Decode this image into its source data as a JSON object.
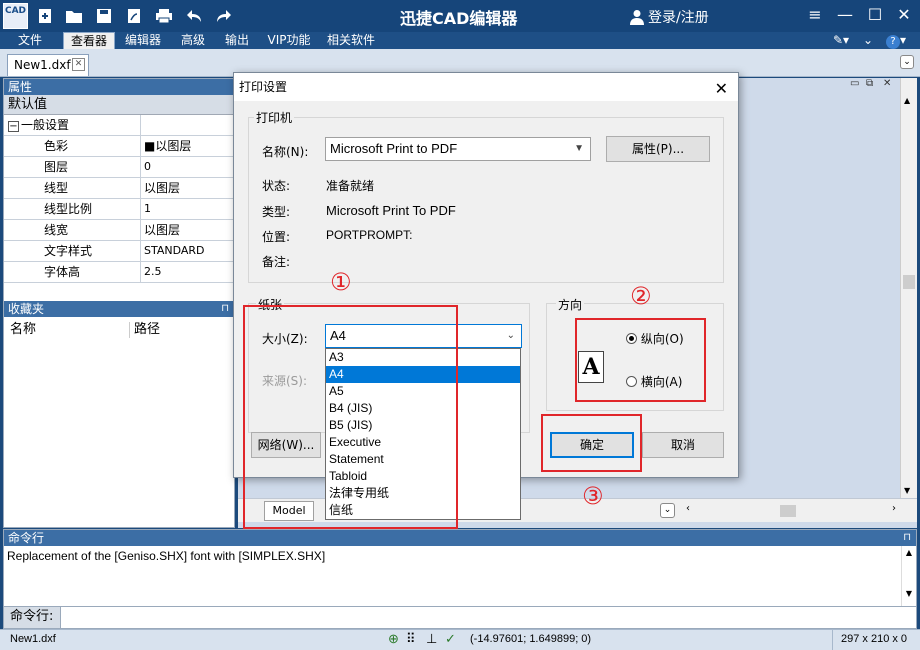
{
  "app": {
    "title": "迅捷CAD编辑器",
    "logo_text": "CAD",
    "login": "登录/注册"
  },
  "menu": [
    {
      "label": "文件",
      "active": false
    },
    {
      "label": "查看器",
      "active": true
    },
    {
      "label": "编辑器",
      "active": false
    },
    {
      "label": "高级",
      "active": false
    },
    {
      "label": "输出",
      "active": false
    },
    {
      "label": "VIP功能",
      "active": false
    },
    {
      "label": "相关软件",
      "active": false
    }
  ],
  "doc_tab": {
    "name": "New1.dxf"
  },
  "properties": {
    "header": "属性",
    "default_label": "默认值",
    "group": "一般设置",
    "rows": [
      {
        "key": "色彩",
        "value": "■以图层"
      },
      {
        "key": "图层",
        "value": "0"
      },
      {
        "key": "线型",
        "value": "以图层"
      },
      {
        "key": "线型比例",
        "value": "1"
      },
      {
        "key": "线宽",
        "value": "以图层"
      },
      {
        "key": "文字样式",
        "value": "STANDARD"
      },
      {
        "key": "字体高",
        "value": "2.5"
      }
    ]
  },
  "favorites": {
    "header": "收藏夹",
    "col_name": "名称",
    "col_path": "路径"
  },
  "model_tab": "Model",
  "command": {
    "header": "命令行",
    "output": "Replacement of the [Geniso.SHX] font with [SIMPLEX.SHX]",
    "input_label": "命令行:"
  },
  "status": {
    "file": "New1.dxf",
    "coords": "(-14.97601; 1.649899; 0)",
    "size": "297 x 210 x 0"
  },
  "dialog": {
    "title": "打印设置",
    "printer_group": "打印机",
    "name_label": "名称(N):",
    "name_value": "Microsoft Print to PDF",
    "properties_button": "属性(P)...",
    "status_label": "状态:",
    "status_value": "准备就绪",
    "type_label": "类型:",
    "type_value": "Microsoft Print To PDF",
    "location_label": "位置:",
    "location_value": "PORTPROMPT:",
    "comment_label": "备注:",
    "paper_group": "纸张",
    "size_label": "大小(Z):",
    "size_value": "A4",
    "source_label": "来源(S):",
    "size_options": [
      "A3",
      "A4",
      "A5",
      "B4 (JIS)",
      "B5 (JIS)",
      "Executive",
      "Statement",
      "Tabloid",
      "法律专用纸",
      "信纸"
    ],
    "selected_index": 1,
    "orientation_group": "方向",
    "portrait_label": "纵向(O)",
    "landscape_label": "横向(A)",
    "orientation": "portrait",
    "orientation_glyph": "A",
    "network_button": "网络(W)...",
    "ok_button": "确定",
    "cancel_button": "取消"
  },
  "annotations": {
    "n1": "①",
    "n2": "②",
    "n3": "③",
    "color": "#e0262a"
  }
}
